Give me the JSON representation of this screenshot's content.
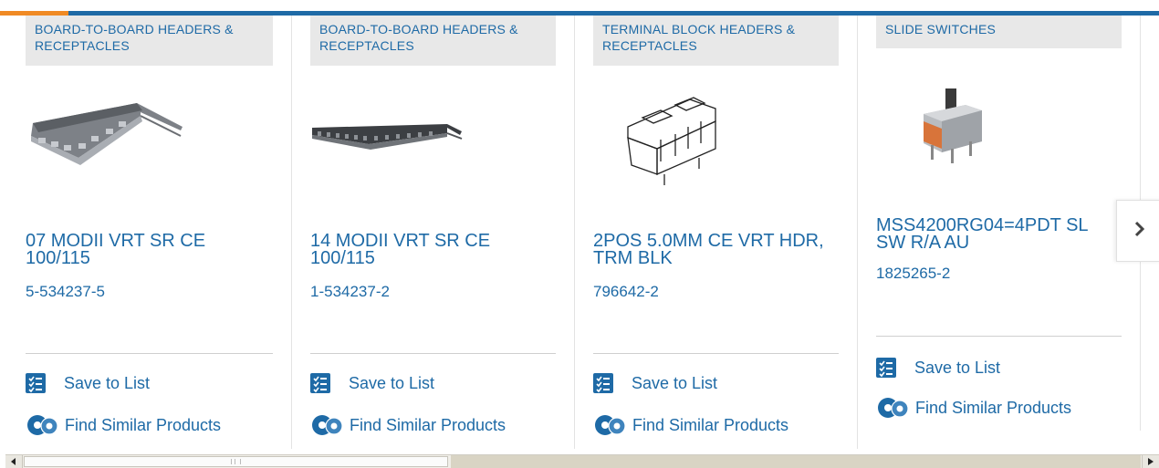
{
  "colors": {
    "link_blue": "#1e6aa6",
    "category_bg": "#e8e8e8",
    "accent_orange": "#f08a24"
  },
  "products": [
    {
      "category": "BOARD-TO-BOARD HEADERS & RECEPTACLES",
      "title": "07 MODII VRT SR CE 100/115",
      "part_number": "5-534237-5",
      "save_label": "Save to List",
      "similar_label": "Find Similar Products",
      "image": "7-position receptacle connector"
    },
    {
      "category": "BOARD-TO-BOARD HEADERS & RECEPTACLES",
      "title": "14 MODII VRT SR CE 100/115",
      "part_number": "1-534237-2",
      "save_label": "Save to List",
      "similar_label": "Find Similar Products",
      "image": "14-position receptacle connector"
    },
    {
      "category": "TERMINAL BLOCK HEADERS & RECEPTACLES",
      "title": "2POS 5.0MM CE VRT HDR, TRM BLK",
      "part_number": "796642-2",
      "save_label": "Save to List",
      "similar_label": "Find Similar Products",
      "image": "terminal block header line drawing"
    },
    {
      "category": "SLIDE SWITCHES",
      "title": "MSS4200RG04=4PDT SL SW R/A AU",
      "part_number": "1825265-2",
      "save_label": "Save to List",
      "similar_label": "Find Similar Products",
      "image": "slide switch"
    }
  ],
  "carousel": {
    "next_icon": "chevron-right-icon"
  },
  "scrollbar": {
    "left_icon": "scroll-left-arrow",
    "right_icon": "scroll-right-arrow"
  }
}
